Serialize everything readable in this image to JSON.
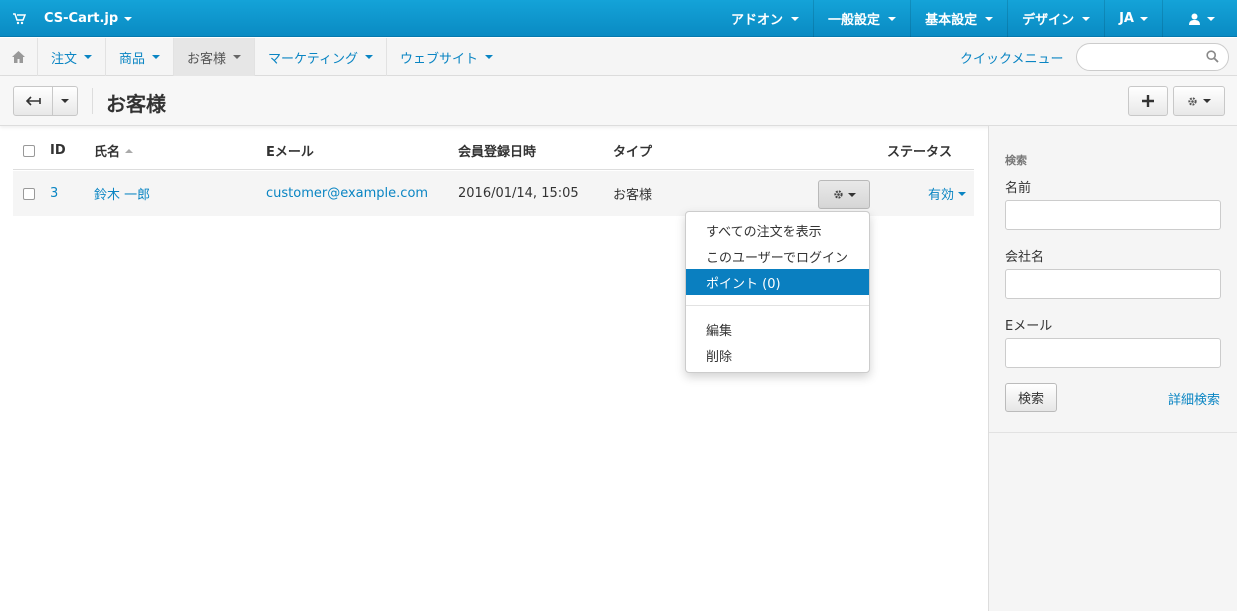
{
  "topbar": {
    "brand": "CS-Cart.jp",
    "menu": [
      {
        "label": "アドオン"
      },
      {
        "label": "一般設定"
      },
      {
        "label": "基本設定"
      },
      {
        "label": "デザイン"
      },
      {
        "label": "JA"
      }
    ]
  },
  "nav": {
    "items": [
      {
        "label": "注文"
      },
      {
        "label": "商品"
      },
      {
        "label": "お客様"
      },
      {
        "label": "マーケティング"
      },
      {
        "label": "ウェブサイト"
      }
    ],
    "quick_menu": "クイックメニュー",
    "search_placeholder": ""
  },
  "page": {
    "title": "お客様"
  },
  "table": {
    "headers": {
      "id": "ID",
      "name": "氏名",
      "email": "Eメール",
      "registered": "会員登録日時",
      "type": "タイプ",
      "status": "ステータス"
    },
    "rows": [
      {
        "id": "3",
        "name": "鈴木 一郎",
        "email": "customer@example.com",
        "registered": "2016/01/14, 15:05",
        "type": "お客様",
        "status": "有効"
      }
    ]
  },
  "row_actions": {
    "items": [
      {
        "label": "すべての注文を表示"
      },
      {
        "label": "このユーザーでログイン"
      },
      {
        "label": "ポイント (0)"
      },
      {
        "label": "編集"
      },
      {
        "label": "削除"
      }
    ],
    "selected_index": 2
  },
  "sidebar": {
    "heading": "検索",
    "fields": [
      {
        "label": "名前",
        "value": ""
      },
      {
        "label": "会社名",
        "value": ""
      },
      {
        "label": "Eメール",
        "value": ""
      }
    ],
    "search_button": "検索",
    "advanced_link": "詳細検索"
  },
  "colors": {
    "accent": "#0a85c3",
    "topbar": "#0a8bc3",
    "selected_item": "#0a7fc0"
  }
}
